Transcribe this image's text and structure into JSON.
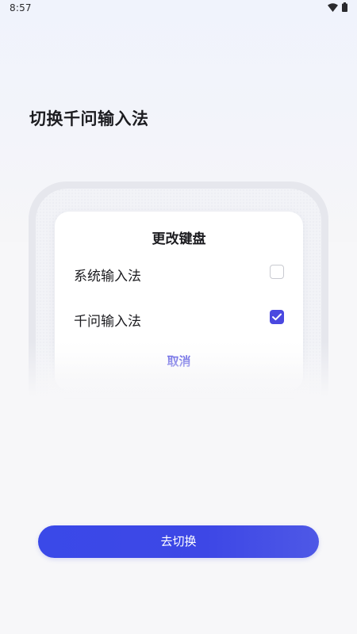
{
  "status_bar": {
    "time": "8:57",
    "icons": [
      "wifi-icon",
      "battery-icon"
    ]
  },
  "page": {
    "title": "切换千问输入法"
  },
  "dialog": {
    "title": "更改键盘",
    "options": [
      {
        "label": "系统输入法",
        "checked": false
      },
      {
        "label": "千问输入法",
        "checked": true
      }
    ],
    "cancel_label": "取消"
  },
  "primary_action": {
    "label": "去切换"
  },
  "colors": {
    "accent": "#4a48e0",
    "button": "#3d47e6",
    "background": "#f7f7f9"
  }
}
